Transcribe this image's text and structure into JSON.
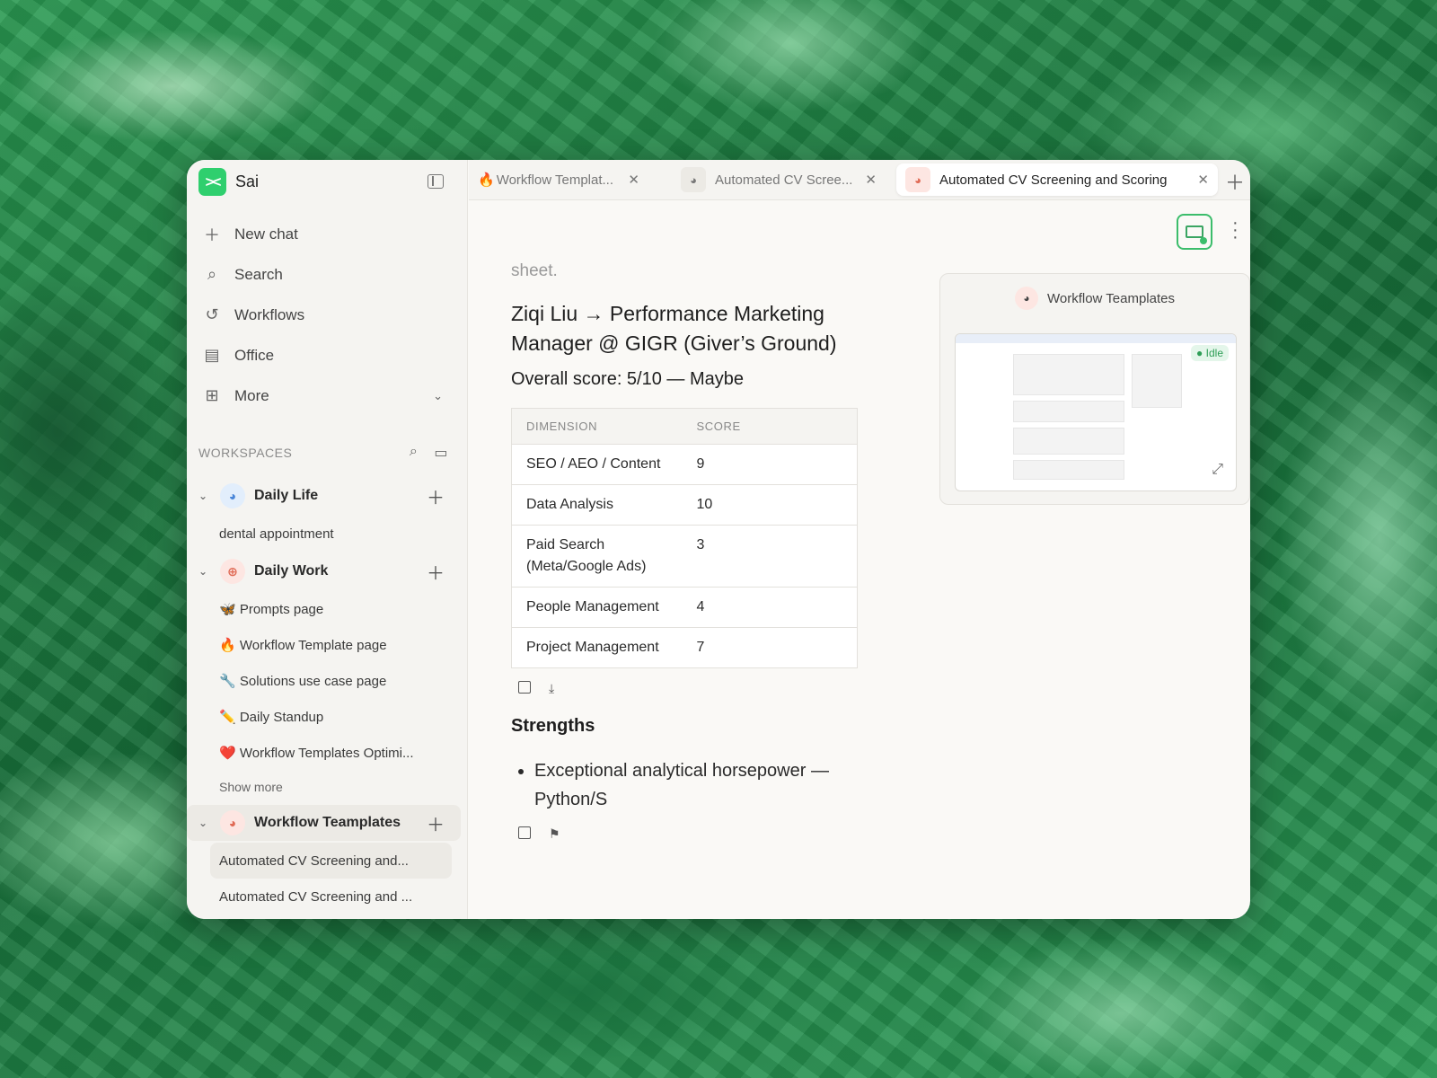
{
  "sidebar": {
    "brand": "Sai",
    "nav": [
      {
        "label": "New chat",
        "icon": "plus-icon"
      },
      {
        "label": "Search",
        "icon": "search-icon"
      },
      {
        "label": "Workflows",
        "icon": "history-icon"
      },
      {
        "label": "Office",
        "icon": "building-icon"
      },
      {
        "label": "More",
        "icon": "grid-icon"
      }
    ],
    "workspaces_label": "WORKSPACES",
    "groups": [
      {
        "name": "Daily Life",
        "children": [
          "dental appointment"
        ]
      },
      {
        "name": "Daily Work",
        "children": [
          "🦋 Prompts page",
          "🔥 Workflow Template page",
          "🔧 Solutions use case page",
          "✏️ Daily Standup",
          "❤️ Workflow Templates Optimi..."
        ],
        "show_more": "Show more"
      },
      {
        "name": "Workflow Teamplates",
        "children": [
          "Automated CV Screening and...",
          "Automated CV Screening and ..."
        ]
      }
    ]
  },
  "tabs": [
    {
      "label": "Workflow Templat...",
      "active": false
    },
    {
      "label": "Automated CV Scree...",
      "active": false
    },
    {
      "label": "Automated CV Screening and Scoring",
      "active": true
    }
  ],
  "content": {
    "fade_text": "sheet.",
    "title": "Ziqi Liu → Performance Marketing Manager @ GIGR (Giver’s Ground)",
    "score_line": "Overall score: 5/10 — Maybe",
    "table": {
      "headers": [
        "DIMENSION",
        "SCORE"
      ],
      "rows": [
        [
          "SEO / AEO / Content",
          "9"
        ],
        [
          "Data Analysis",
          "10"
        ],
        [
          "Paid Search (Meta/Google Ads)",
          "3"
        ],
        [
          "People Management",
          "4"
        ],
        [
          "Project Management",
          "7"
        ]
      ]
    },
    "strengths_heading": "Strengths",
    "strengths": [
      "Exceptional analytical horsepower — Python/S"
    ]
  },
  "preview": {
    "title": "Workflow Teamplates",
    "status": "Idle"
  }
}
